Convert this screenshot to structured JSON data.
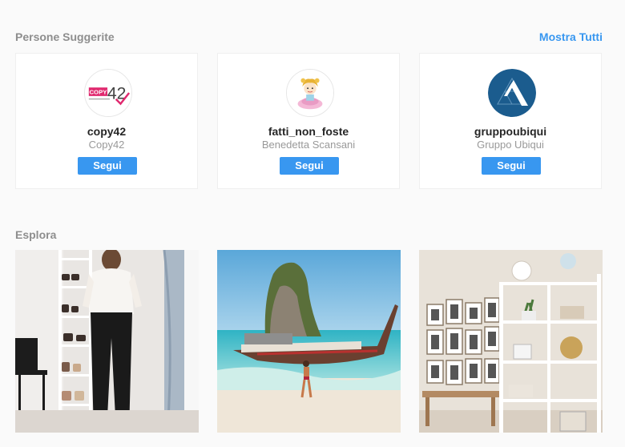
{
  "suggested": {
    "title": "Persone Suggerite",
    "show_all_label": "Mostra Tutti",
    "people": [
      {
        "username": "copy42",
        "fullname": "Copy42",
        "follow_label": "Segui",
        "avatar_logo": {
          "badge": "COPY",
          "number": "42"
        }
      },
      {
        "username": "fatti_non_foste",
        "fullname": "Benedetta Scansani",
        "follow_label": "Segui"
      },
      {
        "username": "gruppoubiqui",
        "fullname": "Gruppo Ubiqui",
        "follow_label": "Segui"
      }
    ]
  },
  "explore": {
    "title": "Esplora",
    "tiles": [
      "outfit-photo",
      "beach-longtail-boat-photo",
      "shelf-interior-photo"
    ]
  },
  "colors": {
    "accent": "#3897f0",
    "background": "#fafafa",
    "muted_text": "#999999"
  }
}
